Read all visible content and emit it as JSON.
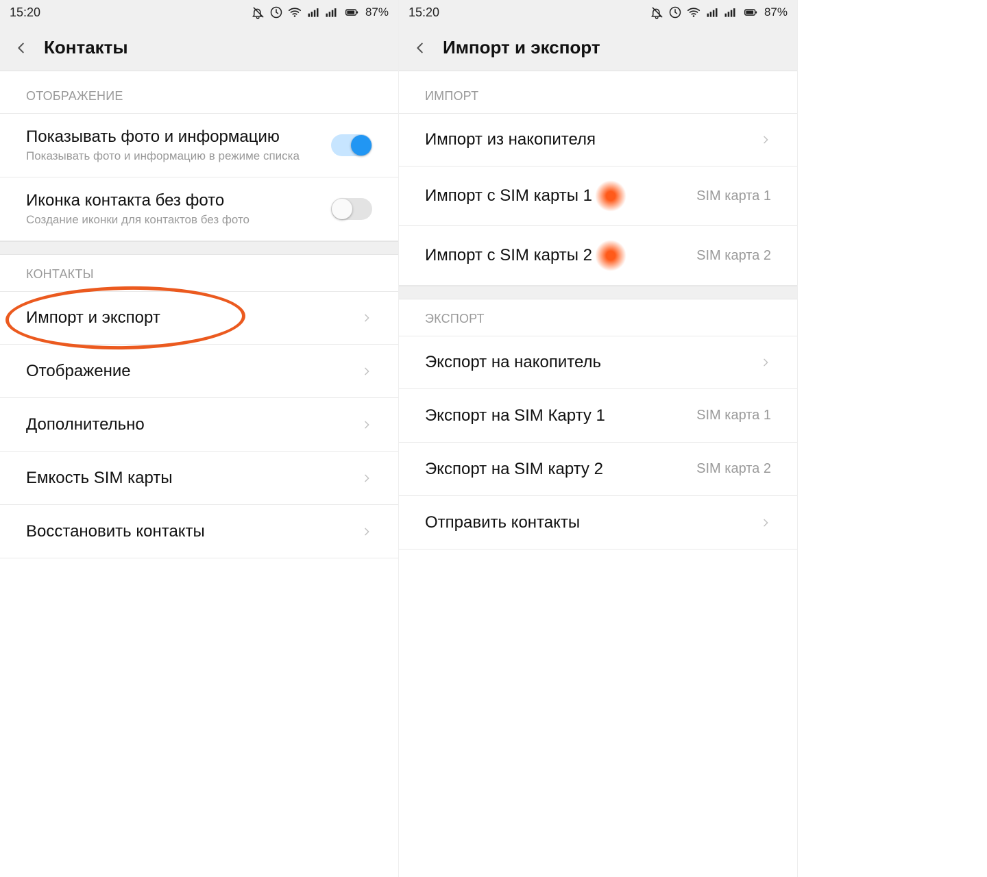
{
  "status": {
    "time": "15:20",
    "battery": "87%"
  },
  "left": {
    "title": "Контакты",
    "section_display": "ОТОБРАЖЕНИЕ",
    "row_photo": {
      "label": "Показывать фото и информацию",
      "sub": "Показывать фото и информацию в режиме списка"
    },
    "row_icon": {
      "label": "Иконка контакта без фото",
      "sub": "Создание иконки для контактов без фото"
    },
    "section_contacts": "КОНТАКТЫ",
    "items": {
      "import_export": "Импорт и экспорт",
      "display": "Отображение",
      "extra": "Дополнительно",
      "sim_capacity": "Емкость SIM карты",
      "restore": "Восстановить контакты"
    }
  },
  "right": {
    "title": "Импорт и экспорт",
    "section_import": "ИМПОРТ",
    "import_storage": "Импорт из накопителя",
    "import_sim1": {
      "label": "Импорт с SIM карты 1",
      "value": "SIM карта 1"
    },
    "import_sim2": {
      "label": "Импорт с SIM карты 2",
      "value": "SIM карта 2"
    },
    "section_export": "ЭКСПОРТ",
    "export_storage": "Экспорт на накопитель",
    "export_sim1": {
      "label": "Экспорт на SIM Карту 1",
      "value": "SIM карта 1"
    },
    "export_sim2": {
      "label": "Экспорт на SIM карту 2",
      "value": "SIM карта 2"
    },
    "send": "Отправить контакты"
  }
}
